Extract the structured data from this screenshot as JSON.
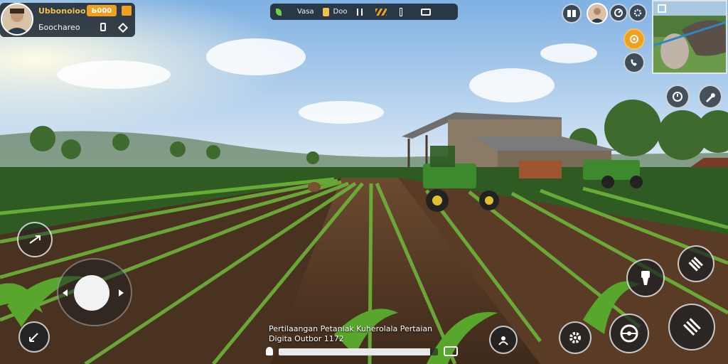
{
  "player": {
    "name": "Ubbonoioo",
    "currency_badge": "Ь000",
    "status": "Бoochareo"
  },
  "top_bar": {
    "item1": "Vasa",
    "item2": "Doo"
  },
  "caption": {
    "line1": "Pertilaangan Petaniak Kuherolala Pertaian",
    "line2": "Digita Outbor 1172"
  },
  "progress": {
    "fraction": 0.95
  },
  "colors": {
    "hud_bg": "#141c24",
    "accent_gold": "#f0a020",
    "tractor_green": "#3d8a2e",
    "soil": "#5b3d28"
  },
  "icons": {
    "top_left": [
      "avatar",
      "coin-icon",
      "lock-icon",
      "tag-icon"
    ],
    "top_bar": [
      "leaf-icon",
      "fuel-icon",
      "signal-icon",
      "flag-icon",
      "battery-icon"
    ],
    "right_column": [
      "book-icon",
      "profile-icon",
      "speed-icon",
      "settings-icon",
      "target-icon",
      "phone-icon",
      "clock-icon",
      "wrench-icon"
    ],
    "bottom_right": [
      "brush-icon",
      "plow-icon",
      "seed-icon",
      "gear-icon",
      "steering-wheel-icon",
      "ride-icon"
    ],
    "bottom_left": [
      "camera-rotate-icon",
      "joystick",
      "minimap-icon"
    ]
  }
}
